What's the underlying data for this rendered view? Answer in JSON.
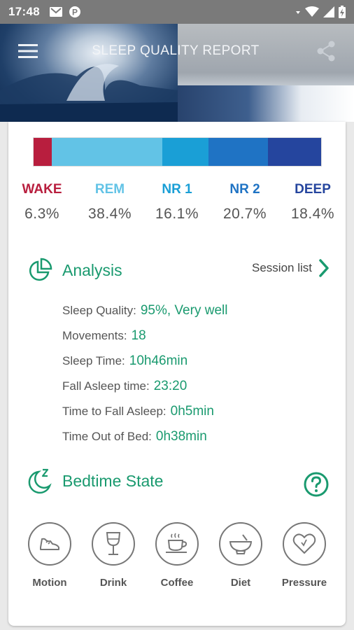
{
  "status_bar": {
    "time": "17:48",
    "left_icons": [
      "gmail-icon",
      "parking-icon"
    ],
    "right_icons": [
      "signal-dot-icon",
      "wifi-icon",
      "cellular-icon",
      "battery-icon"
    ]
  },
  "header": {
    "title": "SLEEP QUALITY REPORT",
    "menu_icon": "hamburger-icon",
    "share_icon": "share-icon"
  },
  "stages": [
    {
      "name": "WAKE",
      "percent": "6.3%",
      "value": 6.3,
      "color": "#b81e3e"
    },
    {
      "name": "REM",
      "percent": "38.4%",
      "value": 38.4,
      "color": "#62c3e6"
    },
    {
      "name": "NR 1",
      "percent": "16.1%",
      "value": 16.1,
      "color": "#1a9fd6"
    },
    {
      "name": "NR 2",
      "percent": "20.7%",
      "value": 20.7,
      "color": "#1f73c4"
    },
    {
      "name": "DEEP",
      "percent": "18.4%",
      "value": 18.4,
      "color": "#25459e"
    }
  ],
  "analysis": {
    "title": "Analysis",
    "icon": "pie-chart-icon",
    "session_link": "Session list",
    "rows": [
      {
        "label": "Sleep Quality:",
        "value": "95%, Very well"
      },
      {
        "label": "Movements:",
        "value": "18"
      },
      {
        "label": "Sleep Time:",
        "value": "10h46min"
      },
      {
        "label": "Fall Asleep time:",
        "value": "23:20"
      },
      {
        "label": "Time to Fall Asleep:",
        "value": "0h5min"
      },
      {
        "label": "Time Out of Bed:",
        "value": "0h38min"
      }
    ]
  },
  "bedtime": {
    "title": "Bedtime State",
    "icon": "moon-sleep-icon",
    "help_icon": "help-icon",
    "items": [
      {
        "label": "Motion",
        "icon": "shoe-icon"
      },
      {
        "label": "Drink",
        "icon": "wine-glass-icon"
      },
      {
        "label": "Coffee",
        "icon": "coffee-cup-icon"
      },
      {
        "label": "Diet",
        "icon": "bowl-icon"
      },
      {
        "label": "Pressure",
        "icon": "heart-icon"
      }
    ]
  },
  "colors": {
    "accent": "#1a9a6f",
    "status_bar": "#7a7a7a"
  }
}
